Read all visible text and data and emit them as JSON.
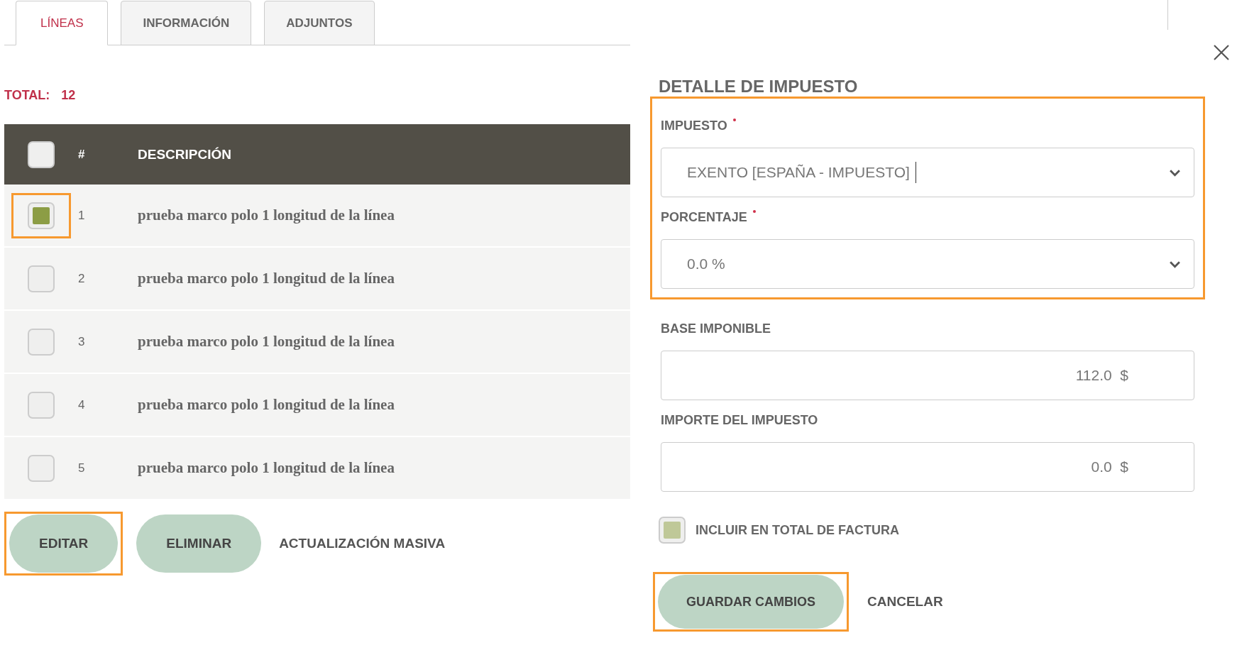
{
  "tabs": [
    {
      "label": "LÍNEAS",
      "selected": true
    },
    {
      "label": "INFORMACIÓN",
      "selected": false
    },
    {
      "label": "ADJUNTOS",
      "selected": false
    }
  ],
  "total": {
    "label": "TOTAL:",
    "value": "12"
  },
  "table": {
    "header_checked": false,
    "columns": [
      "#",
      "DESCRIPCIÓN"
    ],
    "rows": [
      {
        "number": "1",
        "description": "prueba marco polo 1 longitud de la línea",
        "checked": true,
        "highlighted": true
      },
      {
        "number": "2",
        "description": "prueba marco polo 1 longitud de la línea",
        "checked": false,
        "highlighted": false
      },
      {
        "number": "3",
        "description": "prueba marco polo 1 longitud de la línea",
        "checked": false,
        "highlighted": false
      },
      {
        "number": "4",
        "description": "prueba marco polo 1 longitud de la línea",
        "checked": false,
        "highlighted": false
      },
      {
        "number": "5",
        "description": "prueba marco polo 1 longitud de la línea",
        "checked": false,
        "highlighted": false
      }
    ]
  },
  "actions": [
    {
      "label": "EDITAR",
      "kind": "button",
      "highlighted": true
    },
    {
      "label": "ELIMINAR",
      "kind": "button",
      "highlighted": false
    },
    {
      "label": "ACTUALIZACIÓN MASIVA",
      "kind": "link"
    }
  ],
  "panel": {
    "title": "DETALLE DE IMPUESTO",
    "field_groups": [
      {
        "highlighted": true,
        "fields": [
          {
            "label": "IMPUESTO",
            "required": true,
            "kind": "select",
            "value": "EXENTO [ESPAÑA - IMPUESTO]",
            "focused": true
          },
          {
            "label": "PORCENTAJE",
            "required": true,
            "kind": "select",
            "value": "0.0 %",
            "focused": false
          }
        ]
      },
      {
        "highlighted": false,
        "fields": [
          {
            "label": "BASE IMPONIBLE",
            "required": false,
            "kind": "amount",
            "value": "112.0  $",
            "focused": false
          },
          {
            "label": "IMPORTE DEL IMPUESTO",
            "required": false,
            "kind": "amount",
            "value": "0.0  $",
            "focused": false
          }
        ]
      }
    ],
    "include_total": {
      "label": "INCLUIR EN TOTAL DE FACTURA",
      "checked": true
    },
    "buttons": [
      {
        "label": "GUARDAR CAMBIOS",
        "kind": "button",
        "highlighted": true
      },
      {
        "label": "CANCELAR",
        "kind": "link"
      }
    ]
  }
}
